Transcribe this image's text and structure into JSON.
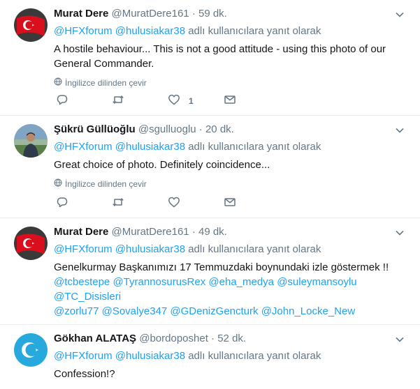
{
  "tweets": [
    {
      "avatar": "turkish-flag",
      "name": "Murat Dere",
      "handle": "@MuratDere161",
      "time": "59 dk.",
      "reply_to_1": "@HFXforum",
      "reply_to_2": "@hulusiakar38",
      "reply_suffix": "adlı kullanıcılara yanıt olarak",
      "text": "A hostile behaviour... This is not a good attitude - using this photo of our General Commander.",
      "translate": "İngilizce dilinden çevir",
      "like_count": "1"
    },
    {
      "avatar": "person-photo",
      "name": "Şükrü Güllüoğlu",
      "handle": "@sgulluoglu",
      "time": "20 dk.",
      "reply_to_1": "@HFXforum",
      "reply_to_2": "@hulusiakar38",
      "reply_suffix": "adlı kullanıcılara yanıt olarak",
      "text": "Great choice of photo. Definitely coincidence...",
      "translate": "İngilizce dilinden çevir"
    },
    {
      "avatar": "turkish-flag",
      "name": "Murat Dere",
      "handle": "@MuratDere161",
      "time": "49 dk.",
      "reply_to_1": "@HFXforum",
      "reply_to_2": "@hulusiakar38",
      "reply_suffix": "adlı kullanıcılara yanıt olarak",
      "text": "Genelkurmay Başkanımızı 17 Temmuzdaki boynundaki izle göstermek !!",
      "mentions_line1": [
        "@tcbestepe",
        "@TyrannosurusRex",
        "@eha_medya",
        "@suleymansoylu",
        "@TC_Disisleri"
      ],
      "mentions_line2": [
        "@zorlu77",
        "@Sovalye347",
        "@GDenizGencturk",
        "@John_Locke_New"
      ]
    },
    {
      "avatar": "blue-crescent-flag",
      "name": "Gökhan ALATAŞ",
      "handle": "@bordoposhet",
      "time": "52 dk.",
      "reply_to_1": "@HFXforum",
      "reply_to_2": "@hulusiakar38",
      "reply_suffix": "adlı kullanıcılara yanıt olarak",
      "text": "Confession!?"
    }
  ],
  "separator": "·",
  "colors": {
    "link": "#1da1f2",
    "muted": "#657786",
    "text": "#14171a",
    "divider": "#e6ecf0"
  },
  "icons": [
    "chevron-down-icon",
    "globe-icon",
    "reply-icon",
    "retweet-icon",
    "like-icon",
    "message-icon"
  ]
}
